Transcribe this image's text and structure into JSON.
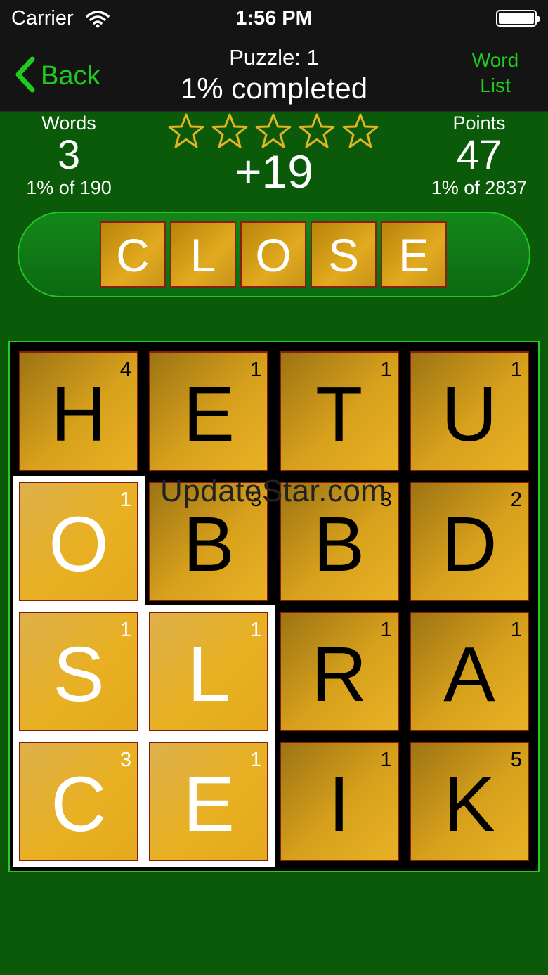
{
  "status_bar": {
    "carrier": "Carrier",
    "time": "1:56 PM"
  },
  "nav": {
    "back_label": "Back",
    "title": "Puzzle: 1",
    "subtitle": "1% completed",
    "word_list_label_line1": "Word",
    "word_list_label_line2": "List"
  },
  "stats": {
    "words_label": "Words",
    "words_value": "3",
    "words_sub": "1% of 190",
    "points_label": "Points",
    "points_value": "47",
    "points_sub": "1% of 2837",
    "bonus": "+19",
    "stars_total": 5
  },
  "current_word": [
    "C",
    "L",
    "O",
    "S",
    "E"
  ],
  "board": [
    [
      {
        "letter": "H",
        "points": "4",
        "selected": false
      },
      {
        "letter": "E",
        "points": "1",
        "selected": false
      },
      {
        "letter": "T",
        "points": "1",
        "selected": false
      },
      {
        "letter": "U",
        "points": "1",
        "selected": false
      }
    ],
    [
      {
        "letter": "O",
        "points": "1",
        "selected": true
      },
      {
        "letter": "B",
        "points": "3",
        "selected": false
      },
      {
        "letter": "B",
        "points": "3",
        "selected": false
      },
      {
        "letter": "D",
        "points": "2",
        "selected": false
      }
    ],
    [
      {
        "letter": "S",
        "points": "1",
        "selected": true
      },
      {
        "letter": "L",
        "points": "1",
        "selected": true
      },
      {
        "letter": "R",
        "points": "1",
        "selected": false
      },
      {
        "letter": "A",
        "points": "1",
        "selected": false
      }
    ],
    [
      {
        "letter": "C",
        "points": "3",
        "selected": true
      },
      {
        "letter": "E",
        "points": "1",
        "selected": true
      },
      {
        "letter": "I",
        "points": "1",
        "selected": false
      },
      {
        "letter": "K",
        "points": "5",
        "selected": false
      }
    ]
  ],
  "watermark": "UpdateStar.com",
  "colors": {
    "accent": "#1ecc1e",
    "background": "#0a5a0a",
    "tile": "#d8a11c",
    "star": "#e6b422"
  }
}
